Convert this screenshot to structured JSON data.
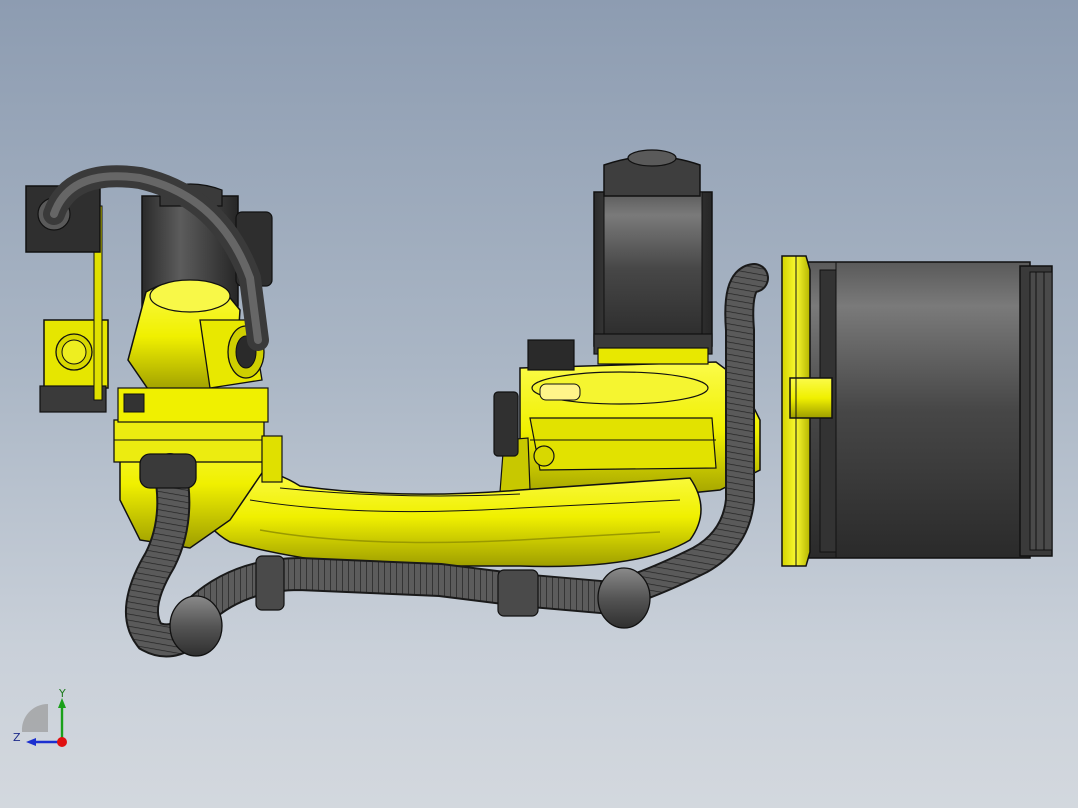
{
  "viewport": {
    "background_top": "#8d9cb1",
    "background_bottom": "#d3d8de"
  },
  "model": {
    "body_color": "#f0f000",
    "body_shadow": "#a8a800",
    "motor_color": "#4a4a4a",
    "motor_dark": "#262626",
    "hose_color": "#5a5a5a",
    "edge_color": "#111111"
  },
  "triad": {
    "y_label": "Y",
    "z_label": "Z",
    "y_color": "#1aa01a",
    "z_color": "#1b2fd0",
    "x_color": "#e01010"
  }
}
